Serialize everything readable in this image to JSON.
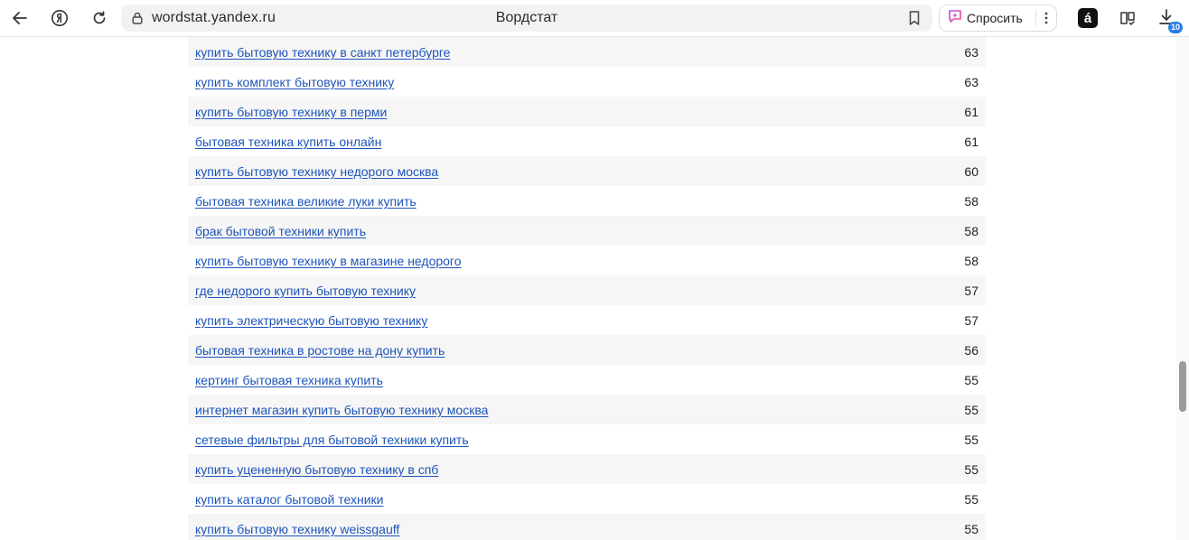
{
  "browser": {
    "url": "wordstat.yandex.ru",
    "title": "Вордстат",
    "ask_label": "Спросить",
    "extension_label": "á",
    "downloads_count": "10",
    "icons": {
      "back": "arrow-left-icon",
      "yandex": "yandex-logo-icon",
      "reload": "reload-icon",
      "lock": "lock-icon",
      "bookmark": "bookmark-icon",
      "ask": "alice-sparkle-icon",
      "more": "more-vertical-icon",
      "collections": "collections-icon",
      "downloads": "download-icon"
    }
  },
  "results": [
    {
      "phrase": "купить бытовую технику в санкт петербурге",
      "count": "63"
    },
    {
      "phrase": "купить комплект бытовую технику",
      "count": "63"
    },
    {
      "phrase": "купить бытовую технику в перми",
      "count": "61"
    },
    {
      "phrase": "бытовая техника купить онлайн",
      "count": "61"
    },
    {
      "phrase": "купить бытовую технику недорого москва",
      "count": "60"
    },
    {
      "phrase": "бытовая техника великие луки купить",
      "count": "58"
    },
    {
      "phrase": "брак бытовой техники купить",
      "count": "58"
    },
    {
      "phrase": "купить бытовую технику в магазине недорого",
      "count": "58"
    },
    {
      "phrase": "где недорого купить бытовую технику",
      "count": "57"
    },
    {
      "phrase": "купить электрическую бытовую технику",
      "count": "57"
    },
    {
      "phrase": "бытовая техника в ростове на дону купить",
      "count": "56"
    },
    {
      "phrase": "кертинг бытовая техника купить",
      "count": "55"
    },
    {
      "phrase": "интернет магазин купить бытовую технику москва",
      "count": "55"
    },
    {
      "phrase": "сетевые фильтры для бытовой техники купить",
      "count": "55"
    },
    {
      "phrase": "купить уцененную бытовую технику в спб",
      "count": "55"
    },
    {
      "phrase": "купить каталог бытовой техники",
      "count": "55"
    },
    {
      "phrase": "купить бытовую технику weissgauff",
      "count": "55"
    }
  ],
  "colors": {
    "link": "#1d54b9",
    "row_alt": "#f6f6f6",
    "badge": "#2a7de1"
  }
}
